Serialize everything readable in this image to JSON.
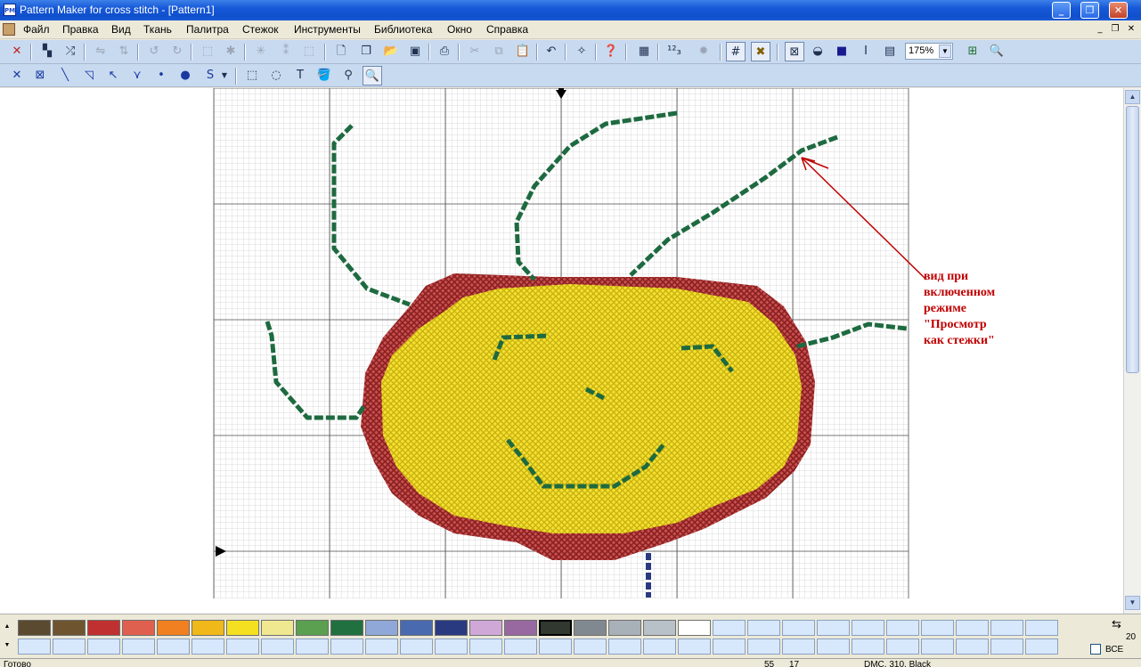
{
  "window": {
    "title": "Pattern Maker for cross stitch - [Pattern1]",
    "app_icon_text": "PM"
  },
  "menubar": {
    "items": [
      "Файл",
      "Правка",
      "Вид",
      "Ткань",
      "Палитра",
      "Стежок",
      "Инструменты",
      "Библиотека",
      "Окно",
      "Справка"
    ]
  },
  "toolbar": {
    "zoom_value": "175%"
  },
  "annotation": {
    "lines": [
      "вид при",
      "включенном",
      "режиме",
      "\"Просмотр",
      "как стежки\""
    ],
    "color": "#c00000"
  },
  "palette": {
    "colors": [
      "#5a4a30",
      "#6e5530",
      "#c03030",
      "#e06050",
      "#f08020",
      "#f0b818",
      "#f4e020",
      "#f0e890",
      "#5aa050",
      "#207040",
      "#90a8d8",
      "#4a6ab0",
      "#2a3a80",
      "#d0a8d8",
      "#9868a0",
      "#303830",
      "#808890",
      "#a8b0b8",
      "#b8c0c8",
      "#ffffff"
    ],
    "selected_index": 15,
    "scroll_value": "20",
    "all_label": "ВСЕ"
  },
  "statusbar": {
    "left": "Готово",
    "x": "55",
    "y": "17",
    "color": "DMC, 310, Black"
  }
}
